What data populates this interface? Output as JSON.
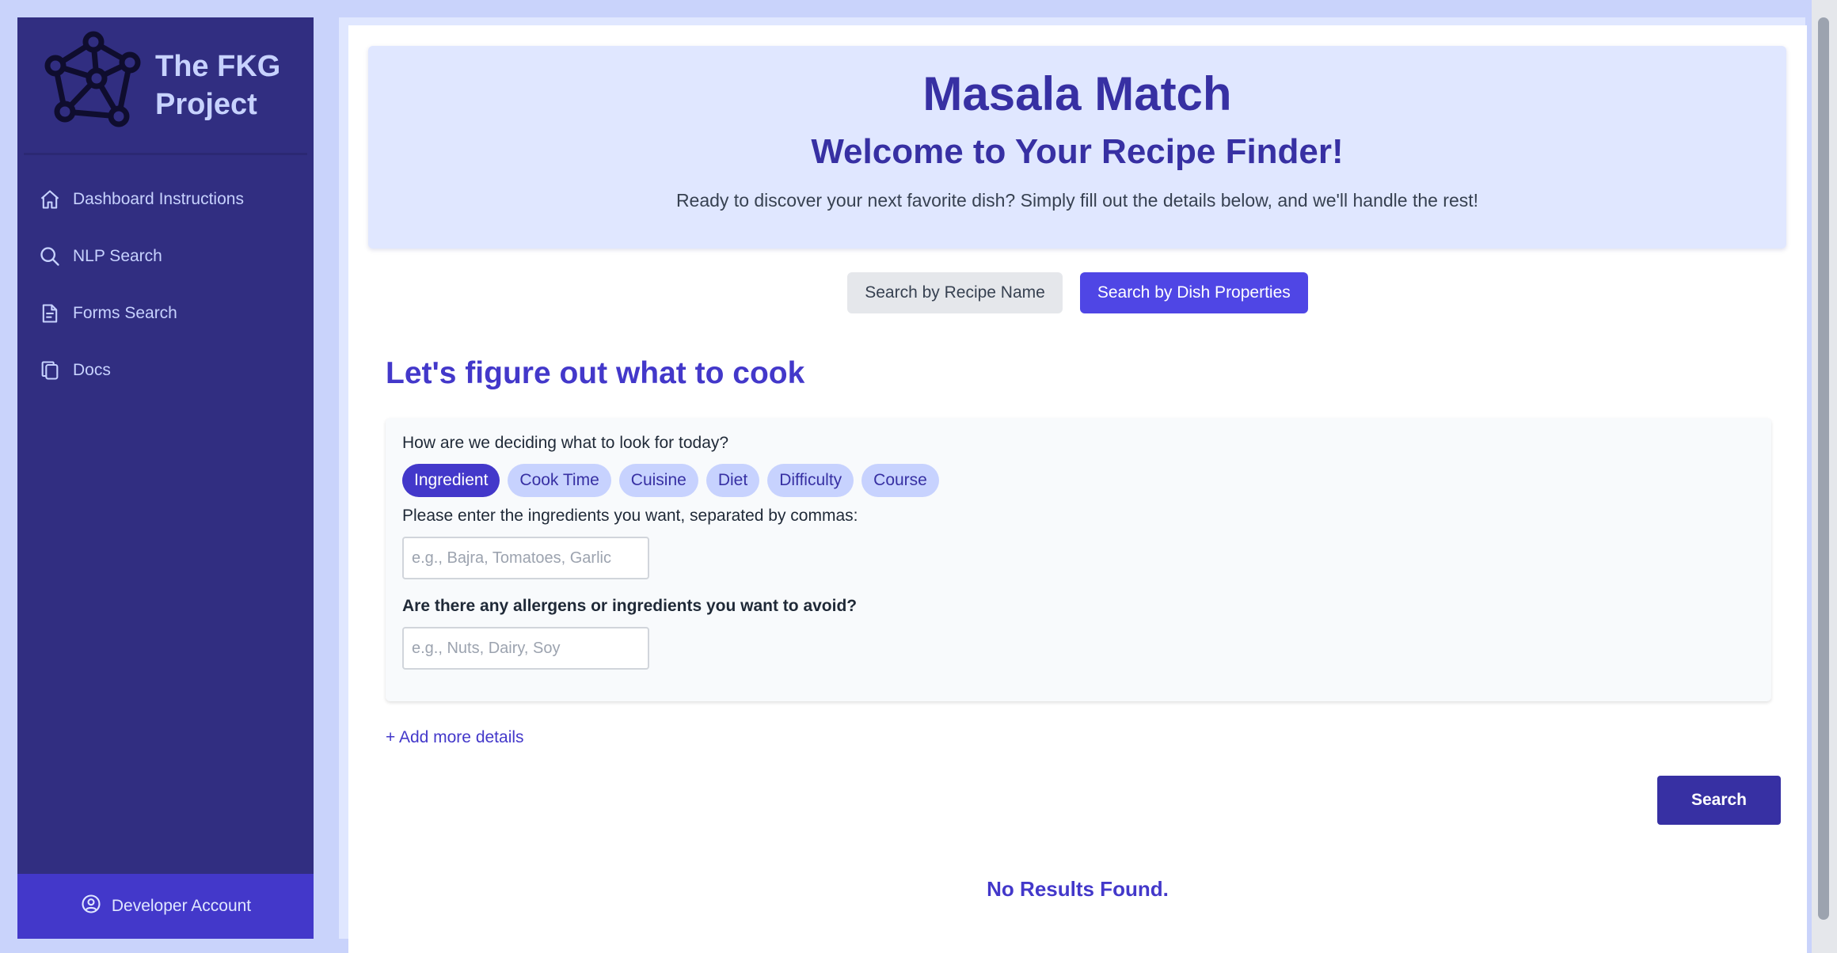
{
  "sidebar": {
    "brand": "The FKG Project",
    "items": [
      {
        "label": "Dashboard Instructions",
        "icon": "home-icon"
      },
      {
        "label": "NLP Search",
        "icon": "search-icon"
      },
      {
        "label": "Forms Search",
        "icon": "document-icon"
      },
      {
        "label": "Docs",
        "icon": "copy-icon"
      }
    ],
    "footer": {
      "label": "Developer Account",
      "icon": "user-circle-icon"
    }
  },
  "hero": {
    "title": "Masala Match",
    "subtitle": "Welcome to Your Recipe Finder!",
    "text": "Ready to discover your next favorite dish? Simply fill out the details below, and we'll handle the rest!"
  },
  "search_modes": {
    "by_name": "Search by Recipe Name",
    "by_properties": "Search by Dish Properties",
    "active": "by_properties"
  },
  "form": {
    "title": "Let's figure out what to cook",
    "question": "How are we deciding what to look for today?",
    "filters": [
      "Ingredient",
      "Cook Time",
      "Cuisine",
      "Diet",
      "Difficulty",
      "Course"
    ],
    "selected_filter": "Ingredient",
    "ingredients_label": "Please enter the ingredients you want, separated by commas:",
    "ingredients_placeholder": "e.g., Bajra, Tomatoes, Garlic",
    "ingredients_value": "",
    "allergens_label": "Are there any allergens or ingredients you want to avoid?",
    "allergens_placeholder": "e.g., Nuts, Dairy, Soy",
    "allergens_value": "",
    "add_more": "+ Add more details",
    "search_button": "Search"
  },
  "results": {
    "message": "No Results Found."
  },
  "colors": {
    "sidebar_bg": "#312e81",
    "accent": "#4338ca",
    "hero_bg": "#e0e7ff"
  }
}
